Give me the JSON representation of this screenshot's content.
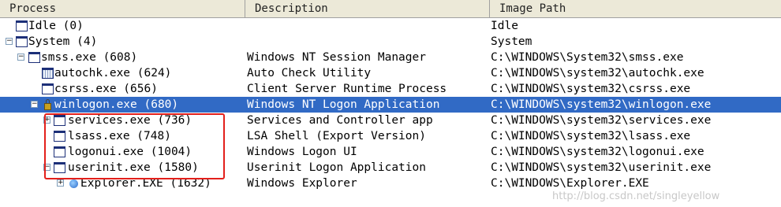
{
  "columns": {
    "process": "Process",
    "description": "Description",
    "image_path": "Image Path"
  },
  "rows": [
    {
      "name": "Idle (0)",
      "description": "",
      "path": "Idle",
      "expander": "",
      "icon": "window-icon"
    },
    {
      "name": "System (4)",
      "description": "",
      "path": "System",
      "expander": "−",
      "icon": "window-icon"
    },
    {
      "name": "smss.exe (608)",
      "description": "Windows NT Session Manager",
      "path": "C:\\WINDOWS\\System32\\smss.exe",
      "expander": "−",
      "icon": "window-icon"
    },
    {
      "name": "autochk.exe (624)",
      "description": "Auto Check Utility",
      "path": "C:\\WINDOWS\\system32\\autochk.exe",
      "expander": "",
      "icon": "grid-window-icon"
    },
    {
      "name": "csrss.exe (656)",
      "description": "Client Server Runtime Process",
      "path": "C:\\WINDOWS\\system32\\csrss.exe",
      "expander": "",
      "icon": "window-icon"
    },
    {
      "name": "winlogon.exe (680)",
      "description": "Windows NT Logon Application",
      "path": "C:\\WINDOWS\\system32\\winlogon.exe",
      "expander": "−",
      "icon": "lock-icon",
      "selected": true
    },
    {
      "name": "services.exe (736)",
      "description": "Services and Controller app",
      "path": "C:\\WINDOWS\\system32\\services.exe",
      "expander": "+",
      "icon": "window-icon"
    },
    {
      "name": "lsass.exe (748)",
      "description": "LSA Shell (Export Version)",
      "path": "C:\\WINDOWS\\system32\\lsass.exe",
      "expander": "",
      "icon": "window-icon"
    },
    {
      "name": "logonui.exe (1004)",
      "description": "Windows Logon UI",
      "path": "C:\\WINDOWS\\system32\\logonui.exe",
      "expander": "",
      "icon": "window-icon"
    },
    {
      "name": "userinit.exe (1580)",
      "description": "Userinit Logon Application",
      "path": "C:\\WINDOWS\\system32\\userinit.exe",
      "expander": "−",
      "icon": "window-icon"
    },
    {
      "name": "Explorer.EXE (1632)",
      "description": "Windows Explorer",
      "path": "C:\\WINDOWS\\Explorer.EXE",
      "expander": "+",
      "icon": "explorer-icon"
    }
  ],
  "watermark": "http://blog.csdn.net/singleyellow",
  "colors": {
    "selected_row": "#316ac5",
    "highlight_box": "#e3201b",
    "header_bg": "#ece9d8"
  }
}
